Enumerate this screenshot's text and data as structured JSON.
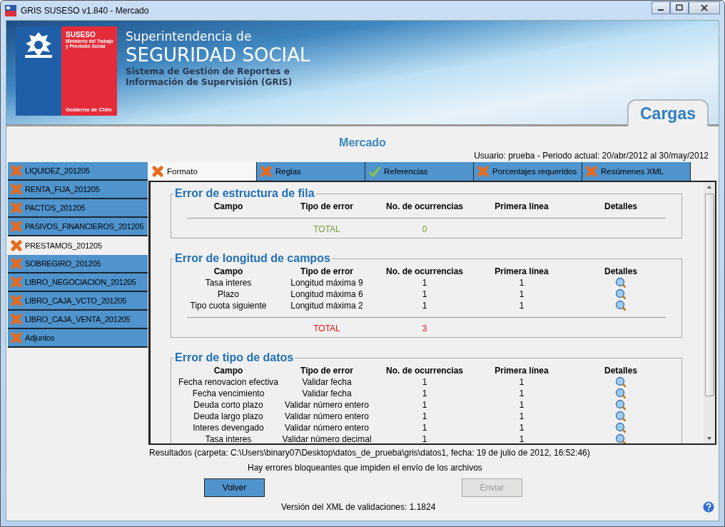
{
  "window": {
    "title": "GRIS SUSESO v1.840 - Mercado"
  },
  "header": {
    "org": "SUSESO",
    "ministry": [
      "Ministerio del Trabajo",
      "y Previsión Social"
    ],
    "government": "Gobierno de Chile",
    "line1": "Superintendencia de",
    "line2": "SEGURIDAD SOCIAL",
    "line3": "Sistema de Gestión de Reportes e",
    "line4": "Información de Supervisión (GRIS)",
    "section_tab": "Cargas"
  },
  "page_title": "Mercado",
  "user_info": "Usuario: prueba - Periodo actual: 20/abr/2012 al 30/may/2012",
  "sidebar": {
    "items": [
      {
        "label": "LIQUIDEZ_201205",
        "has_errors": true,
        "selected": false
      },
      {
        "label": "RENTA_FIJA_201205",
        "has_errors": true,
        "selected": false
      },
      {
        "label": "PACTOS_201205",
        "has_errors": true,
        "selected": false
      },
      {
        "label": "PASIVOS_FINANCIEROS_201205",
        "has_errors": true,
        "selected": false
      },
      {
        "label": "PRESTAMOS_201205",
        "has_errors": true,
        "selected": true
      },
      {
        "label": "SOBREGIRO_201205",
        "has_errors": true,
        "selected": false
      },
      {
        "label": "LIBRO_NEGOCIACION_201205",
        "has_errors": true,
        "selected": false
      },
      {
        "label": "LIBRO_CAJA_VCTO_201205",
        "has_errors": true,
        "selected": false
      },
      {
        "label": "LIBRO_CAJA_VENTA_201205",
        "has_errors": true,
        "selected": false
      },
      {
        "label": "Adjuntos",
        "has_errors": true,
        "selected": false
      }
    ]
  },
  "tabs": [
    {
      "label": "Formato",
      "has_errors": true,
      "selected": true
    },
    {
      "label": "Reglas",
      "has_errors": true,
      "selected": false
    },
    {
      "label": "Referencias",
      "has_errors": false,
      "selected": false
    },
    {
      "label": "Porcentajes requeridos",
      "has_errors": true,
      "selected": false
    },
    {
      "label": "Resúmenes XML",
      "has_errors": true,
      "selected": false
    }
  ],
  "sections": [
    {
      "title": "Error de estructura de fila",
      "columns": [
        "Campo",
        "Tipo de error",
        "No. de ocurrencias",
        "Primera línea",
        "Detalles"
      ],
      "total_label": "TOTAL",
      "total_value": "0",
      "has_errors": false
    },
    {
      "title": "Error de longitud de campos",
      "columns": [
        "Campo",
        "Tipo de error",
        "No. de ocurrencias",
        "Primera línea",
        "Detalles"
      ],
      "rows": [
        {
          "field": "Tasa interes",
          "error_type": "Longitud máxima 9",
          "occurrences": "1",
          "first_line": "1"
        },
        {
          "field": "Plazo",
          "error_type": "Longitud máxima 6",
          "occurrences": "1",
          "first_line": "1"
        },
        {
          "field": "Tipo cuota siguiente",
          "error_type": "Longitud máxima 2",
          "occurrences": "1",
          "first_line": "1"
        }
      ],
      "total_label": "TOTAL",
      "total_value": "3",
      "has_errors": true
    },
    {
      "title": "Error de tipo de datos",
      "columns": [
        "Campo",
        "Tipo de error",
        "No. de ocurrencias",
        "Primera línea",
        "Detalles"
      ],
      "rows": [
        {
          "field": "Fecha renovacion efectiva",
          "error_type": "Validar fecha",
          "occurrences": "1",
          "first_line": "1"
        },
        {
          "field": "Fecha vencimiento",
          "error_type": "Validar fecha",
          "occurrences": "1",
          "first_line": "1"
        },
        {
          "field": "Deuda corto plazo",
          "error_type": "Validar número entero",
          "occurrences": "1",
          "first_line": "1"
        },
        {
          "field": "Deuda largo plazo",
          "error_type": "Validar número entero",
          "occurrences": "1",
          "first_line": "1"
        },
        {
          "field": "Interes devengado",
          "error_type": "Validar número entero",
          "occurrences": "1",
          "first_line": "1"
        },
        {
          "field": "Tasa interes",
          "error_type": "Validar número decimal",
          "occurrences": "1",
          "first_line": "1"
        }
      ]
    }
  ],
  "results": "Resultados (carpeta: C:\\Users\\binary07\\Desktop\\datos_de_prueba\\gris\\datos1, fecha: 19 de julio de 2012, 16:52:46)",
  "warning": "Hay errores bloqueantes que impiden el envío de los archivos",
  "buttons": [
    {
      "label": "Volver",
      "disabled": false
    },
    {
      "label": "Enviar",
      "disabled": true
    }
  ],
  "version": "Versión del XML de validaciones: 1.1824"
}
